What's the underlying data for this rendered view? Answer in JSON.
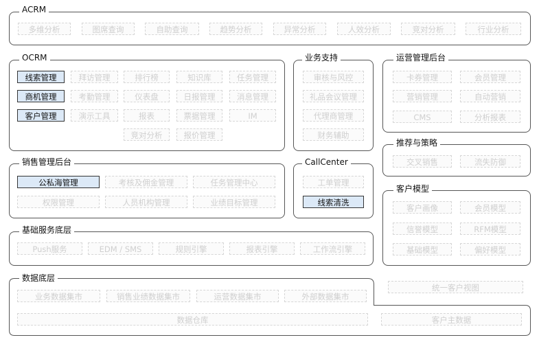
{
  "acrm": {
    "title": "ACRM",
    "items": [
      "多维分析",
      "图席查询",
      "自助查询",
      "趋势分析",
      "异常分析",
      "人效分析",
      "竞对分析",
      "行业分析"
    ]
  },
  "ocrm": {
    "title": "OCRM",
    "row1": [
      "线索管理",
      "拜访管理",
      "排行榜",
      "知识库",
      "任务管理"
    ],
    "row2": [
      "商机管理",
      "考勤管理",
      "仪表盘",
      "日报管理",
      "消息管理"
    ],
    "row3": [
      "客户管理",
      "演示工具",
      "报表",
      "票据管理",
      "IM"
    ],
    "row4": [
      "竞对分析",
      "报价管理"
    ]
  },
  "support": {
    "title": "业务支持",
    "items": [
      "审核与风控",
      "礼品会议管理",
      "代理商管理",
      "财务辅助"
    ]
  },
  "ops": {
    "title": "运营管理后台",
    "items": [
      "卡券管理",
      "会员管理",
      "营销管理",
      "自动营销",
      "CMS",
      "分析报表"
    ]
  },
  "recommend": {
    "title": "推荐与策略",
    "items": [
      "交叉销售",
      "流失防御"
    ]
  },
  "sales": {
    "title": "销售管理后台",
    "row1": [
      "公私海管理",
      "考核及佣金管理",
      "任务管理中心"
    ],
    "row2": [
      "权限管理",
      "人员机构管理",
      "业绩目标管理"
    ]
  },
  "callcenter": {
    "title": "CallCenter",
    "items": [
      "工单管理",
      "线索清洗"
    ]
  },
  "customer_model": {
    "title": "客户模型",
    "items": [
      "客户画像",
      "会员模型",
      "信誉模型",
      "RFM模型",
      "基础模型",
      "偏好模型"
    ]
  },
  "base": {
    "title": "基础服务底层",
    "items": [
      "Push服务",
      "EDM / SMS",
      "规则引擎",
      "报表引擎",
      "工作流引擎"
    ]
  },
  "data_layer": {
    "title": "数据底层",
    "row1": [
      "业务数据集市",
      "销售业绩数据集市",
      "运营数据集市",
      "外部数据集市"
    ],
    "warehouse": "数据仓库",
    "master": "客户主数据"
  },
  "unified_view": "统一客户视图"
}
